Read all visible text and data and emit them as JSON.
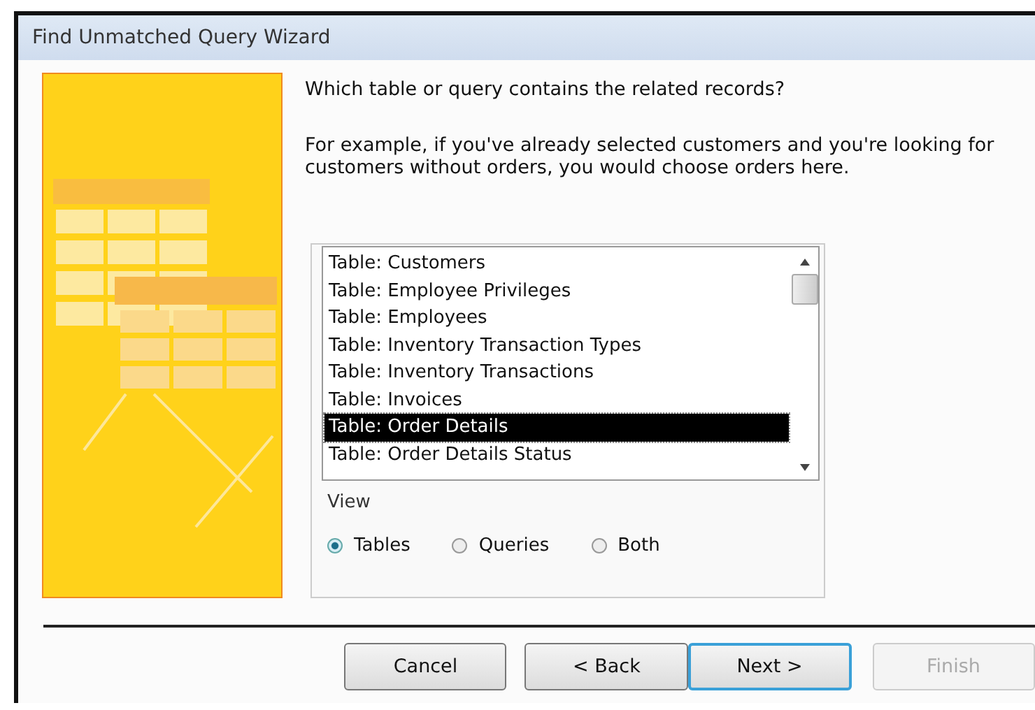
{
  "window": {
    "title": "Find Unmatched Query Wizard"
  },
  "question": "Which table or query contains the related records?",
  "explanation": "For example, if you've already selected customers and you're looking for customers without orders, you would choose orders here.",
  "list": {
    "items": [
      {
        "label": "Table: Customers",
        "selected": false
      },
      {
        "label": "Table: Employee Privileges",
        "selected": false
      },
      {
        "label": "Table: Employees",
        "selected": false
      },
      {
        "label": "Table: Inventory Transaction Types",
        "selected": false
      },
      {
        "label": "Table: Inventory Transactions",
        "selected": false
      },
      {
        "label": "Table: Invoices",
        "selected": false
      },
      {
        "label": "Table: Order Details",
        "selected": true
      },
      {
        "label": "Table: Order Details Status",
        "selected": false
      }
    ]
  },
  "view": {
    "label": "View",
    "options": [
      {
        "label": "Tables",
        "selected": true
      },
      {
        "label": "Queries",
        "selected": false
      },
      {
        "label": "Both",
        "selected": false
      }
    ]
  },
  "buttons": [
    {
      "label": "Cancel",
      "default": false,
      "disabled": false
    },
    {
      "label": "< Back",
      "default": false,
      "disabled": false
    },
    {
      "label": "Next >",
      "default": true,
      "disabled": false
    },
    {
      "label": "Finish",
      "default": false,
      "disabled": true
    }
  ]
}
